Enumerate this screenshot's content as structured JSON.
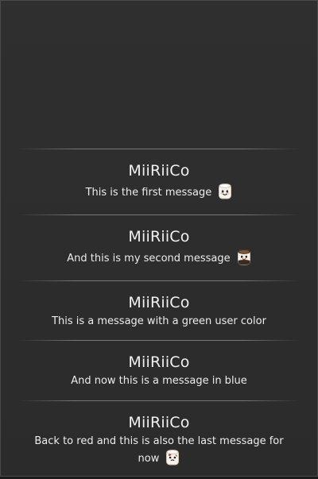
{
  "messages": [
    {
      "user": "MiiRiiCo",
      "text": "This is the first message",
      "emoji": "marshmallow-happy-icon",
      "user_color": "#f1f1f1"
    },
    {
      "user": "MiiRiiCo",
      "text": "And this is my second message",
      "emoji": "marshmallow-toast-icon",
      "user_color": "#f1f1f1"
    },
    {
      "user": "MiiRiiCo",
      "text": "This is a message with a green user color",
      "emoji": "",
      "user_color": "#f1f1f1"
    },
    {
      "user": "MiiRiiCo",
      "text": "And now this is a message in blue",
      "emoji": "",
      "user_color": "#f1f1f1"
    },
    {
      "user": "MiiRiiCo",
      "text": "Back to red and this is also the last message for now",
      "emoji": "marshmallow-hurt-icon",
      "user_color": "#f1f1f1"
    }
  ],
  "theme": {
    "background": "#2d2d2d",
    "divider": "#6b6b6b",
    "text": "#ececec"
  }
}
